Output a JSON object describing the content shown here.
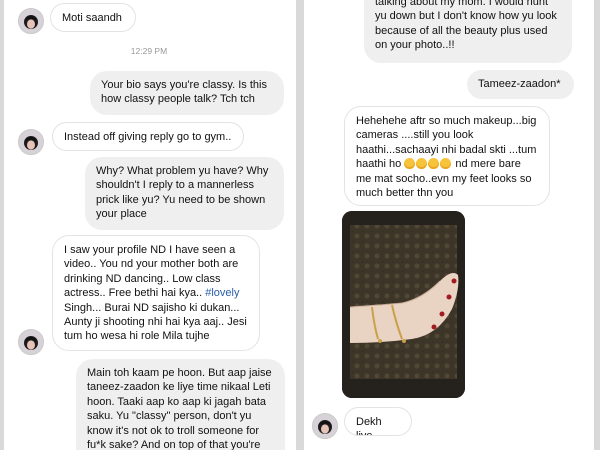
{
  "left_panel": {
    "messages": [
      {
        "text": "Moti saandh"
      },
      {
        "text": "12:29 PM"
      },
      {
        "text": "Your bio says you're classy. Is this how classy people talk? Tch tch"
      },
      {
        "text": "Instead off giving reply go to gym.."
      },
      {
        "text": "Why? What problem yu have? Why shouldn't I reply to a mannerless prick like yu? Yu need to be shown your place"
      },
      {
        "text_before": "I saw your profile ND I have seen a video.. You nd your mother both are drinking ND dancing.. Low class actress.. Free bethi hai kya.. ",
        "hashtag": "#lovely",
        "text_after": " Singh... Burai ND sajisho ki dukan... Aunty ji shooting nhi hai kya aaj.. Jesi tum ho wesa hi role Mila tujhe"
      },
      {
        "text": "Main toh kaam pe hoon. But aap jaise taneez-zaadon ke liye time nikaal Leti hoon. Taaki aap ko aap ki jagah bata saku. Yu \"classy\" person, don't yu know it's not ok to troll someone for fu*k sake? And on top of that you're"
      }
    ]
  },
  "right_panel": {
    "messages": [
      {
        "text": "talking about my mom. I would hunt yu down but I don't know how yu look because of all the beauty plus used on your photo..!!"
      },
      {
        "text": "Tameez-zaadon*"
      },
      {
        "text_before": "Hehehehe aftr so much makeup...big cameras ....still you look haathi...sachaayi nhi badal skti ...tum haathi ho ",
        "text_after": " nd mere bare me mat socho..evn my feet looks so much better thn you",
        "emoji_count": 4
      },
      {
        "text": "Dekh liye"
      }
    ]
  },
  "colors": {
    "outgoing_bubble": "#efefef",
    "incoming_bubble": "#ffffff",
    "hashtag": "#2a5ca8",
    "divider": "#d9d9d9"
  },
  "icons": {
    "avatar": "profile-avatar-icon",
    "photo": "foot-with-anklet-photo"
  }
}
